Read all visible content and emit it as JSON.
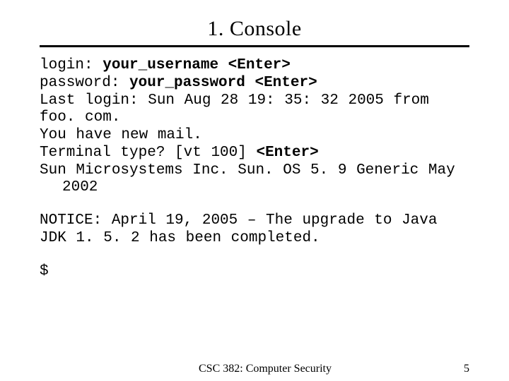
{
  "title": "1. Console",
  "lines": {
    "l1a": "login:",
    "l1b": "your_username",
    "l1c": "<Enter>",
    "l2a": "password:",
    "l2b": "your_password",
    "l2c": "<Enter>",
    "l3": "Last login: Sun Aug 28 19: 35: 32 2005 from foo. com.",
    "l4": "You have new mail.",
    "l5a": "Terminal type? [vt 100]",
    "l5b": "<Enter>",
    "l6": "Sun Microsystems Inc.  Sun. OS 5. 9  Generic May",
    "l6b": "2002",
    "l7": "NOTICE: April 19, 2005 – The upgrade to Java JDK 1. 5. 2 has been completed.",
    "prompt": "$"
  },
  "footer": {
    "center": "CSC 382: Computer Security",
    "page": "5"
  }
}
